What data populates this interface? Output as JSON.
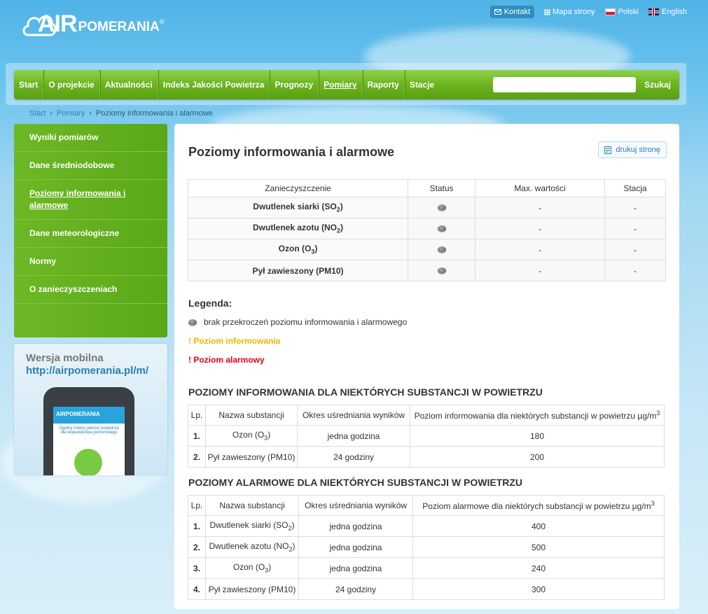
{
  "header": {
    "logo_air": "AIR",
    "logo_pomerania": "POMERANIA",
    "logo_reg": "®",
    "kontakt": "Kontakt",
    "mapa": "Mapa strony",
    "polski": "Polski",
    "english": "English"
  },
  "nav": {
    "items": [
      "Start",
      "O projekcie",
      "Aktualności",
      "Indeks Jakości Powietrza",
      "Prognozy",
      "Pomiary",
      "Raporty",
      "Stacje"
    ],
    "search_button": "Szukaj"
  },
  "breadcrumb": {
    "start": "Start",
    "pomiary": "Pomiary",
    "current": "Poziomy informowania i alarmowe"
  },
  "sidebar": {
    "items": [
      "Wyniki pomiarów",
      "Dane średniodobowe",
      "Poziomy informowania i alarmowe",
      "Dane meteorologiczne",
      "Normy",
      "O zanieczyszczeniach"
    ],
    "mobile_title": "Wersja mobilna",
    "mobile_url": "http://airpomerania.pl/m/",
    "phone_logo": "AIRPOMERANIA",
    "phone_text": "Ogólny indeks jakości powietrza dla województwa pomorskiego"
  },
  "main": {
    "title": "Poziomy informowania i alarmowe",
    "print": "drukuj stronę",
    "status_table": {
      "headers": [
        "Zanieczyszczenie",
        "Status",
        "Max. wartości",
        "Stacja"
      ],
      "rows": [
        {
          "name": "Dwutlenek siarki (SO",
          "sub": "2",
          "tail": ")",
          "max": "-",
          "station": "-"
        },
        {
          "name": "Dwutlenek azotu (NO",
          "sub": "2",
          "tail": ")",
          "max": "-",
          "station": "-"
        },
        {
          "name": "Ozon (O",
          "sub": "3",
          "tail": ")",
          "max": "-",
          "station": "-"
        },
        {
          "name": "Pył zawieszony (PM10)",
          "sub": "",
          "tail": "",
          "max": "-",
          "station": "-"
        }
      ]
    },
    "legend": {
      "title": "Legenda:",
      "none": "brak przekroczeń poziomu informowania i alarmowego",
      "info": "! Poziom informowania",
      "alarm": "! Poziom alarmowy"
    },
    "info_section": {
      "title": "POZIOMY INFORMOWANIA DLA NIEKTÓRYCH SUBSTANCJI W POWIETRZU",
      "headers": [
        "Lp.",
        "Nazwa substancji",
        "Okres uśredniania wyników",
        "Poziom informowania dla niektórych substancji w powietrzu µg/m",
        "3"
      ],
      "rows": [
        {
          "lp": "1.",
          "name": "Ozon (O",
          "sub": "3",
          "tail": ")",
          "period": "jedna godzina",
          "level": "180"
        },
        {
          "lp": "2.",
          "name": "Pył zawieszony (PM10)",
          "sub": "",
          "tail": "",
          "period": "24 godziny",
          "level": "200"
        }
      ]
    },
    "alarm_section": {
      "title": "POZIOMY ALARMOWE DLA NIEKTÓRYCH SUBSTANCJI W POWIETRZU",
      "headers": [
        "Lp.",
        "Nazwa substancji",
        "Okres uśredniania wyników",
        "Poziom alarmowe dla niektórych substancji w powietrzu  µg/m",
        "3"
      ],
      "rows": [
        {
          "lp": "1.",
          "name": "Dwutlenek siarki (SO",
          "sub": "2",
          "tail": ")",
          "period": "jedna godzina",
          "level": "400"
        },
        {
          "lp": "2.",
          "name": "Dwutlenek azotu (NO",
          "sub": "2",
          "tail": ")",
          "period": "jedna godzina",
          "level": "500"
        },
        {
          "lp": "3.",
          "name": "Ozon (O",
          "sub": "3",
          "tail": ")",
          "period": "jedna godzina",
          "level": "240"
        },
        {
          "lp": "4.",
          "name": "Pył zawieszony (PM10)",
          "sub": "",
          "tail": "",
          "period": "24 godziny",
          "level": "300"
        }
      ]
    }
  }
}
